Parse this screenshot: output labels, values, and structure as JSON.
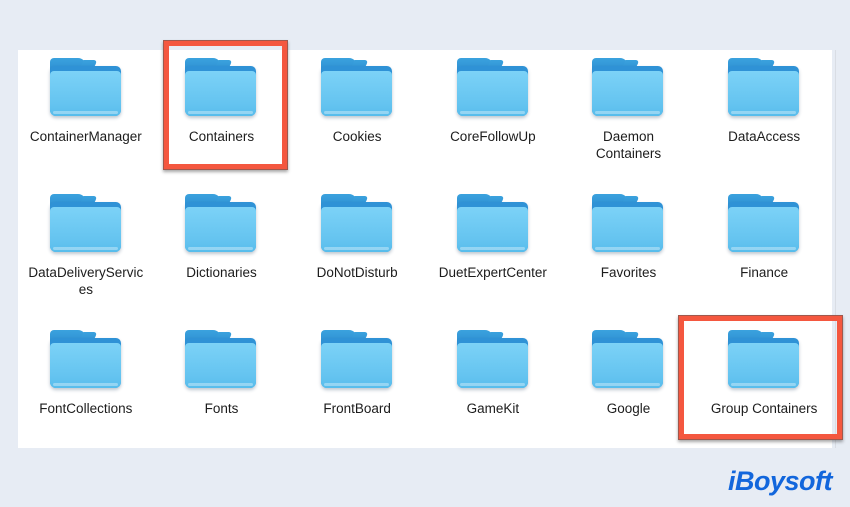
{
  "window": {
    "background_color": "#e7ecf4",
    "panel_color": "#ffffff"
  },
  "folders": [
    {
      "label": "ContainerManager",
      "icon": "folder-icon",
      "highlighted": false
    },
    {
      "label": "Containers",
      "icon": "folder-icon",
      "highlighted": true
    },
    {
      "label": "Cookies",
      "icon": "folder-icon",
      "highlighted": false
    },
    {
      "label": "CoreFollowUp",
      "icon": "folder-icon",
      "highlighted": false
    },
    {
      "label": "Daemon Containers",
      "icon": "folder-icon",
      "highlighted": false
    },
    {
      "label": "DataAccess",
      "icon": "folder-icon",
      "highlighted": false
    },
    {
      "label": "DataDeliveryServices",
      "icon": "folder-icon",
      "highlighted": false
    },
    {
      "label": "Dictionaries",
      "icon": "folder-icon",
      "highlighted": false
    },
    {
      "label": "DoNotDisturb",
      "icon": "folder-icon",
      "highlighted": false
    },
    {
      "label": "DuetExpertCenter",
      "icon": "folder-icon",
      "highlighted": false
    },
    {
      "label": "Favorites",
      "icon": "folder-icon",
      "highlighted": false
    },
    {
      "label": "Finance",
      "icon": "folder-icon",
      "highlighted": false
    },
    {
      "label": "FontCollections",
      "icon": "folder-icon",
      "highlighted": false
    },
    {
      "label": "Fonts",
      "icon": "folder-icon",
      "highlighted": false
    },
    {
      "label": "FrontBoard",
      "icon": "folder-icon",
      "highlighted": false
    },
    {
      "label": "GameKit",
      "icon": "folder-icon",
      "highlighted": false
    },
    {
      "label": "Google",
      "icon": "folder-icon",
      "highlighted": false
    },
    {
      "label": "Group Containers",
      "icon": "folder-icon",
      "highlighted": true
    }
  ],
  "annotations": [
    {
      "name": "containers",
      "target": "Containers",
      "color": "#f4573f"
    },
    {
      "name": "group-containers",
      "target": "Group Containers",
      "color": "#f4573f"
    }
  ],
  "watermark": {
    "text": "iBoysoft",
    "color": "#1266dc"
  }
}
